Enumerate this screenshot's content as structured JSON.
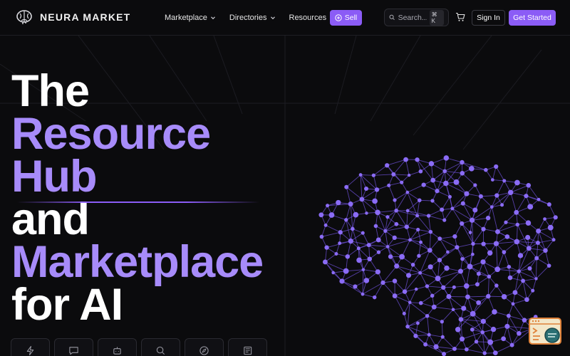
{
  "header": {
    "brand": "NEURA MARKET",
    "logo_icon": "brain-logo-icon",
    "menu": [
      {
        "label": "Marketplace"
      },
      {
        "label": "Directories"
      },
      {
        "label": "Resources"
      }
    ],
    "sell_label": "Sell",
    "search_placeholder": "Search...",
    "search_shortcut": "⌘ K",
    "signin_label": "Sign In",
    "get_started_label": "Get Started"
  },
  "hero": {
    "lines": [
      {
        "text": "The",
        "color": "white"
      },
      {
        "text": "Resource",
        "color": "purple"
      },
      {
        "text": "Hub",
        "color": "purple"
      },
      {
        "text": "and",
        "color": "white"
      },
      {
        "text": "Marketplace",
        "color": "purple"
      },
      {
        "text": "for AI",
        "color": "white"
      }
    ]
  },
  "categories": [
    {
      "icon": "lightning-icon"
    },
    {
      "icon": "chat-bubble-icon"
    },
    {
      "icon": "robot-icon"
    },
    {
      "icon": "search-icon"
    },
    {
      "icon": "compass-icon"
    },
    {
      "icon": "newspaper-icon"
    }
  ],
  "colors": {
    "background": "#0b0b0d",
    "accent": "#8b5cf6",
    "accent_light": "#a78bfa",
    "text": "#ffffff"
  }
}
